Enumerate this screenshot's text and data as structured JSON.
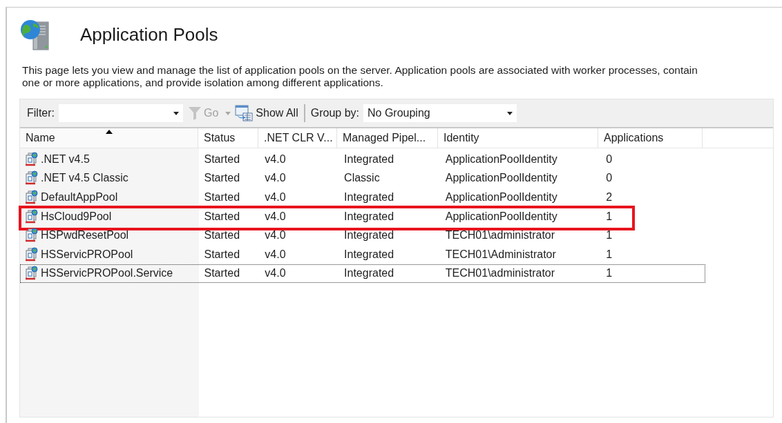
{
  "header": {
    "title": "Application Pools",
    "description": "This page lets you view and manage the list of application pools on the server. Application pools are associated with worker processes, contain one or more applications, and provide isolation among different applications."
  },
  "toolbar": {
    "filter_label": "Filter:",
    "go_label": "Go",
    "go_disabled": true,
    "show_all_label": "Show All",
    "group_by_label": "Group by:",
    "group_by_value": "No Grouping"
  },
  "table": {
    "columns": [
      {
        "label": "Name",
        "sorted": true
      },
      {
        "label": "Status",
        "sorted": false
      },
      {
        "label": ".NET CLR V...",
        "sorted": false
      },
      {
        "label": "Managed Pipel...",
        "sorted": false
      },
      {
        "label": "Identity",
        "sorted": false
      },
      {
        "label": "Applications",
        "sorted": false
      }
    ],
    "rows": [
      {
        "cells": [
          ".NET v4.5",
          "Started",
          "v4.0",
          "Integrated",
          "ApplicationPoolIdentity",
          "0"
        ],
        "highlighted": false,
        "focused": false
      },
      {
        "cells": [
          ".NET v4.5 Classic",
          "Started",
          "v4.0",
          "Classic",
          "ApplicationPoolIdentity",
          "0"
        ],
        "highlighted": false,
        "focused": false
      },
      {
        "cells": [
          "DefaultAppPool",
          "Started",
          "v4.0",
          "Integrated",
          "ApplicationPoolIdentity",
          "2"
        ],
        "highlighted": false,
        "focused": false
      },
      {
        "cells": [
          "HsCloud9Pool",
          "Started",
          "v4.0",
          "Integrated",
          "ApplicationPoolIdentity",
          "1"
        ],
        "highlighted": true,
        "focused": false
      },
      {
        "cells": [
          "HSPwdResetPool",
          "Started",
          "v4.0",
          "Integrated",
          "TECH01\\administrator",
          "1"
        ],
        "highlighted": false,
        "focused": false
      },
      {
        "cells": [
          "HSServicPROPool",
          "Started",
          "v4.0",
          "Integrated",
          "TECH01\\Administrator",
          "1"
        ],
        "highlighted": false,
        "focused": false
      },
      {
        "cells": [
          "HSServicPROPool.Service",
          "Started",
          "v4.0",
          "Integrated",
          "TECH01\\administrator",
          "1"
        ],
        "highlighted": false,
        "focused": true
      }
    ]
  }
}
